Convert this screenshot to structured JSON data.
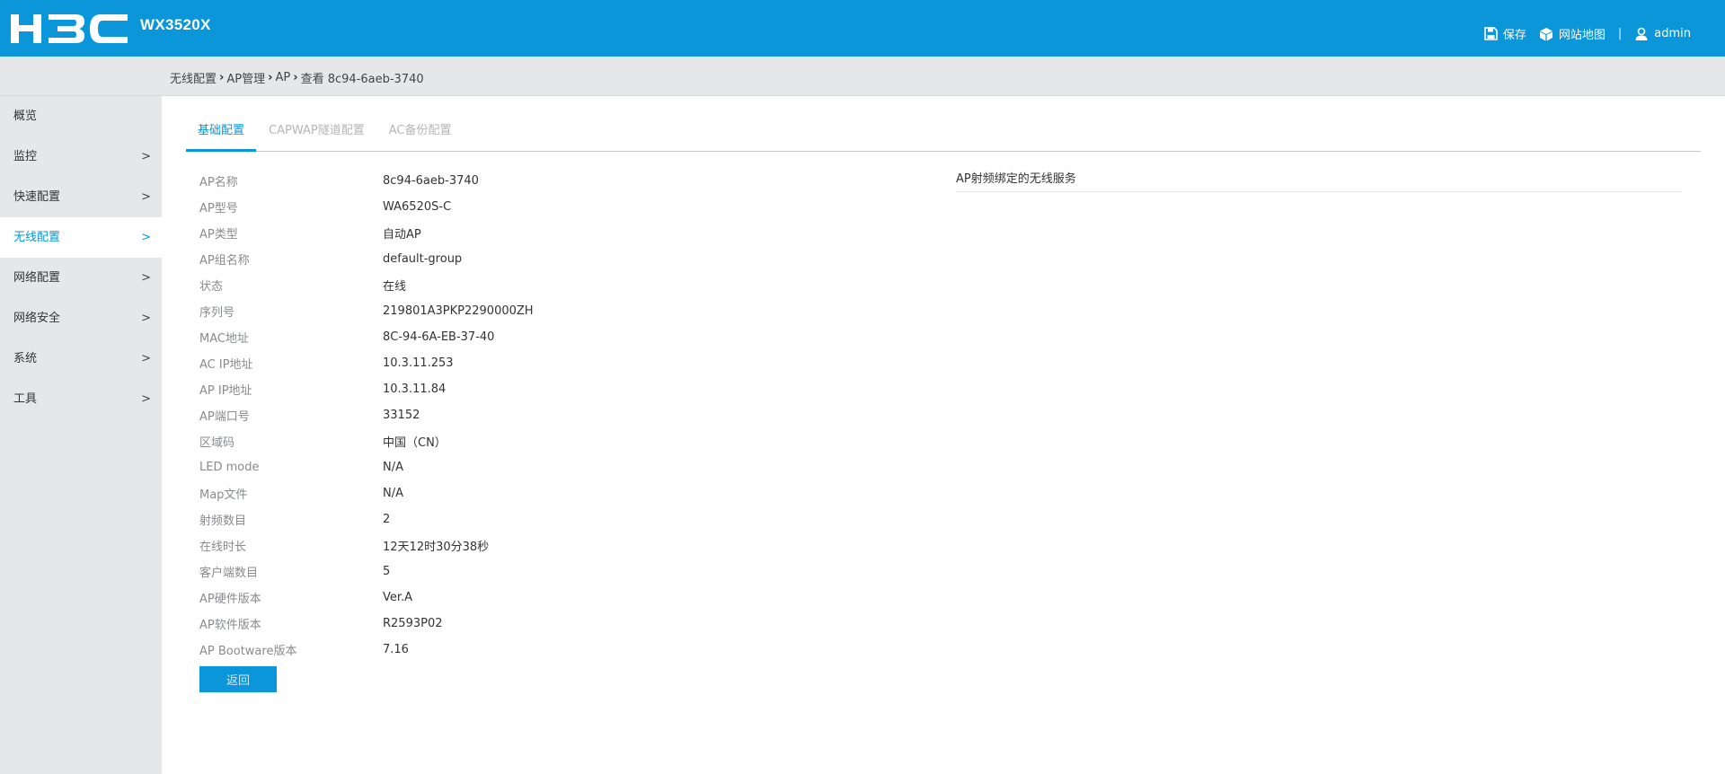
{
  "header": {
    "model": "WX3520X",
    "save_label": "保存",
    "sitemap_label": "网站地图",
    "separator": "|",
    "user_label": "admin"
  },
  "breadcrumb": [
    "无线配置",
    "AP管理",
    "AP",
    "查看 8c94-6aeb-3740"
  ],
  "sidebar": {
    "items": [
      {
        "label": "概览"
      },
      {
        "label": "监控"
      },
      {
        "label": "快速配置"
      },
      {
        "label": "无线配置"
      },
      {
        "label": "网络配置"
      },
      {
        "label": "网络安全"
      },
      {
        "label": "系统"
      },
      {
        "label": "工具"
      }
    ]
  },
  "tabs": [
    {
      "label": "基础配置"
    },
    {
      "label": "CAPWAP隧道配置"
    },
    {
      "label": "AC备份配置"
    }
  ],
  "details": [
    {
      "label": "AP名称",
      "value": "8c94-6aeb-3740"
    },
    {
      "label": "AP型号",
      "value": "WA6520S-C"
    },
    {
      "label": "AP类型",
      "value": "自动AP"
    },
    {
      "label": "AP组名称",
      "value": "default-group"
    },
    {
      "label": "状态",
      "value": "在线"
    },
    {
      "label": "序列号",
      "value": "219801A3PKP2290000ZH"
    },
    {
      "label": "MAC地址",
      "value": "8C-94-6A-EB-37-40"
    },
    {
      "label": "AC IP地址",
      "value": "10.3.11.253"
    },
    {
      "label": "AP IP地址",
      "value": "10.3.11.84"
    },
    {
      "label": "AP端口号",
      "value": "33152"
    },
    {
      "label": "区域码",
      "value": "中国（CN）"
    },
    {
      "label": "LED mode",
      "value": "N/A"
    },
    {
      "label": "Map文件",
      "value": "N/A"
    },
    {
      "label": "射频数目",
      "value": "2"
    },
    {
      "label": "在线时长",
      "value": "12天12时30分38秒"
    },
    {
      "label": "客户端数目",
      "value": "5"
    },
    {
      "label": "AP硬件版本",
      "value": "Ver.A"
    },
    {
      "label": "AP软件版本",
      "value": "R2593P02"
    },
    {
      "label": "AP Bootware版本",
      "value": "7.16"
    }
  ],
  "back_button": "返回",
  "service_panel_title": "AP射频绑定的无线服务",
  "colors": {
    "brand": "#0a96d8",
    "sidebar_bg": "#e6e7e8",
    "label_text": "#888a8c"
  }
}
